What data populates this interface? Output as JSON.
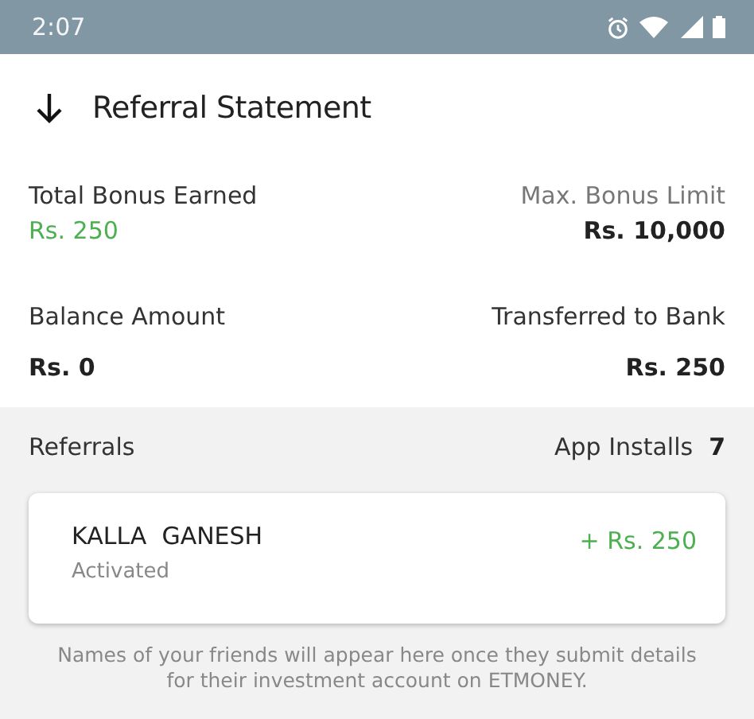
{
  "status_bar": {
    "time": "2:07"
  },
  "header": {
    "title": "Referral Statement"
  },
  "stats": [
    {
      "label": "Total Bonus Earned",
      "value": "Rs. 250",
      "highlight": true,
      "muted": false
    },
    {
      "label": "Max. Bonus Limit",
      "value": "Rs. 10,000",
      "highlight": false,
      "muted": true
    },
    {
      "label": "Balance Amount",
      "value": "Rs. 0",
      "highlight": false,
      "muted": false
    },
    {
      "label": "Transferred to Bank",
      "value": "Rs. 250",
      "highlight": false,
      "muted": false
    }
  ],
  "referrals": {
    "title": "Referrals",
    "installs_label": "App Installs",
    "installs_count": "7",
    "items": [
      {
        "name": "KALLA  GANESH",
        "status": "Activated",
        "amount": "+ Rs. 250"
      }
    ],
    "note": "Names of your friends will appear here once they submit details for their investment account on ETMONEY."
  }
}
